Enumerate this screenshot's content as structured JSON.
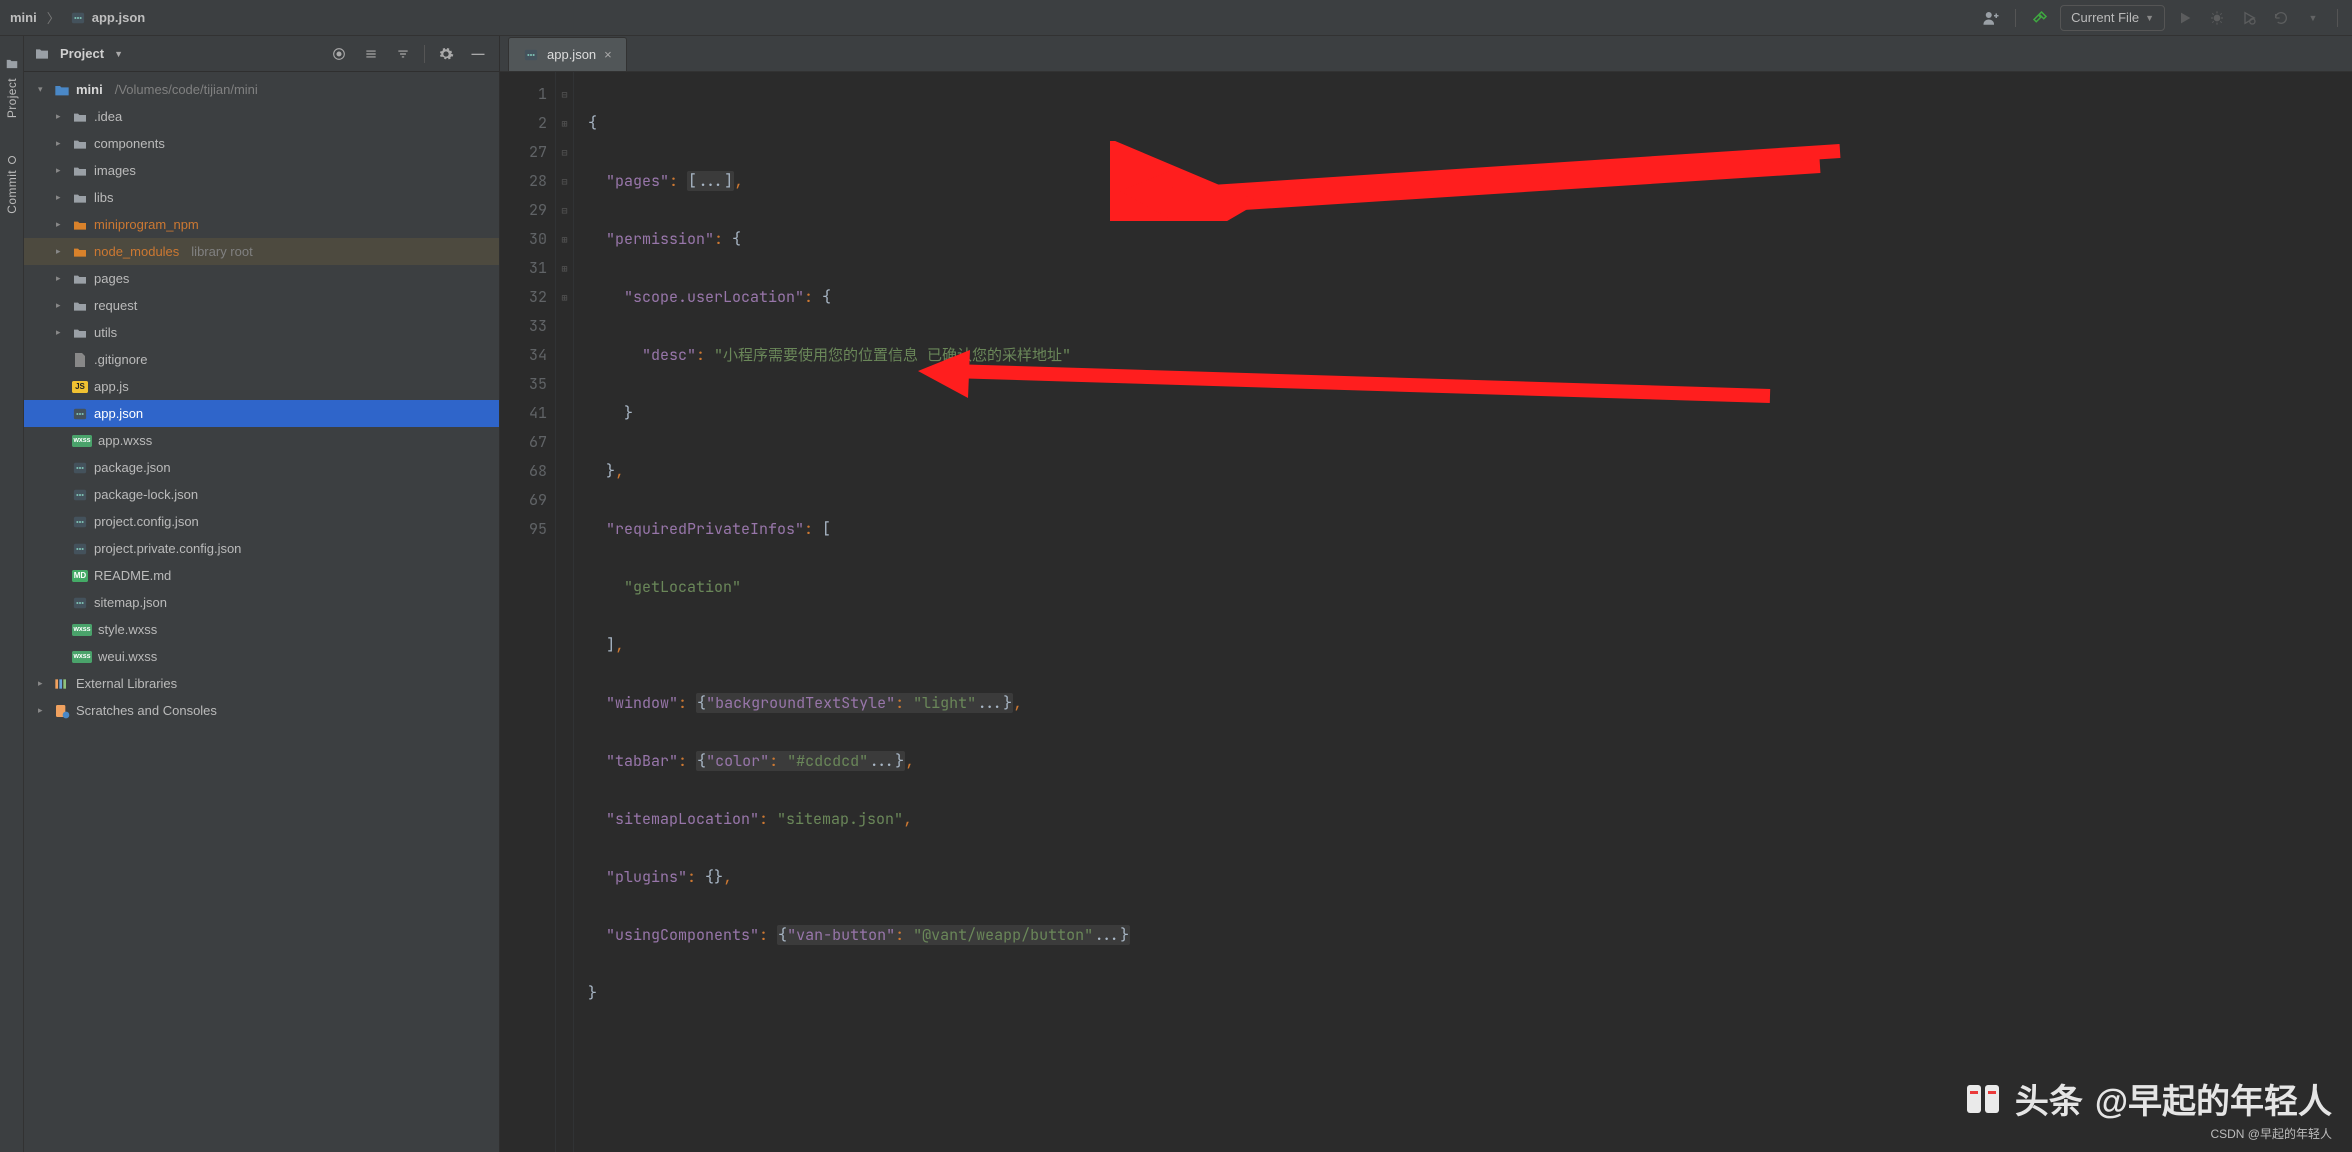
{
  "breadcrumb": {
    "items": [
      "mini",
      "app.json"
    ]
  },
  "toolbar": {
    "run_config_label": "Current File"
  },
  "gutter": {
    "project_label": "Project",
    "commit_label": "Commit"
  },
  "project_header": {
    "title": "Project"
  },
  "tree": {
    "root_name": "mini",
    "root_path": "/Volumes/code/tijian/mini",
    "items": [
      {
        "name": ".idea",
        "type": "folder",
        "depth": 1,
        "expandable": true
      },
      {
        "name": "components",
        "type": "folder",
        "depth": 1,
        "expandable": true
      },
      {
        "name": "images",
        "type": "folder",
        "depth": 1,
        "expandable": true
      },
      {
        "name": "libs",
        "type": "folder",
        "depth": 1,
        "expandable": true
      },
      {
        "name": "miniprogram_npm",
        "type": "folder-orange",
        "depth": 1,
        "expandable": true
      },
      {
        "name": "node_modules",
        "type": "folder-orange",
        "depth": 1,
        "suffix": "library root",
        "class": "lib",
        "expandable": true
      },
      {
        "name": "pages",
        "type": "folder",
        "depth": 1,
        "expandable": true
      },
      {
        "name": "request",
        "type": "folder",
        "depth": 1,
        "expandable": true
      },
      {
        "name": "utils",
        "type": "folder",
        "depth": 1,
        "expandable": true
      },
      {
        "name": ".gitignore",
        "type": "txt",
        "depth": 1
      },
      {
        "name": "app.js",
        "type": "js",
        "depth": 1
      },
      {
        "name": "app.json",
        "type": "json",
        "depth": 1,
        "selected": true
      },
      {
        "name": "app.wxss",
        "type": "wxss",
        "depth": 1
      },
      {
        "name": "package.json",
        "type": "json",
        "depth": 1
      },
      {
        "name": "package-lock.json",
        "type": "json",
        "depth": 1
      },
      {
        "name": "project.config.json",
        "type": "json",
        "depth": 1
      },
      {
        "name": "project.private.config.json",
        "type": "json",
        "depth": 1
      },
      {
        "name": "README.md",
        "type": "md",
        "depth": 1
      },
      {
        "name": "sitemap.json",
        "type": "json",
        "depth": 1
      },
      {
        "name": "style.wxss",
        "type": "wxss",
        "depth": 1
      },
      {
        "name": "weui.wxss",
        "type": "wxss",
        "depth": 1
      }
    ],
    "external_libs_label": "External Libraries",
    "scratches_label": "Scratches and Consoles"
  },
  "editor": {
    "tab_title": "app.json",
    "line_numbers": [
      "1",
      "2",
      "27",
      "28",
      "29",
      "30",
      "31",
      "32",
      "33",
      "34",
      "35",
      "41",
      "67",
      "68",
      "69",
      "95"
    ],
    "code": {
      "l1_open": "{",
      "l2_k": "\"pages\"",
      "l2_v": "[...]",
      "l3_k": "\"permission\"",
      "l4_k": "\"scope.userLocation\"",
      "l5_k": "\"desc\"",
      "l5_v": "\"小程序需要使用您的位置信息 已确认您的采样地址\"",
      "l8_k": "\"requiredPrivateInfos\"",
      "l9_v": "\"getLocation\"",
      "l11_k": "\"window\"",
      "l11_v1": "\"backgroundTextStyle\"",
      "l11_v2": "\"light\"",
      "l12_k": "\"tabBar\"",
      "l12_v1": "\"color\"",
      "l12_v2": "\"#cdcdcd\"",
      "l13_k": "\"sitemapLocation\"",
      "l13_v": "\"sitemap.json\"",
      "l14_k": "\"plugins\"",
      "l15_k": "\"usingComponents\"",
      "l15_v1": "\"van-button\"",
      "l15_v2": "\"@vant/weapp/button\""
    }
  },
  "watermark": {
    "brand": "头条",
    "handle": "@早起的年轻人",
    "sub": "CSDN @早起的年轻人"
  }
}
